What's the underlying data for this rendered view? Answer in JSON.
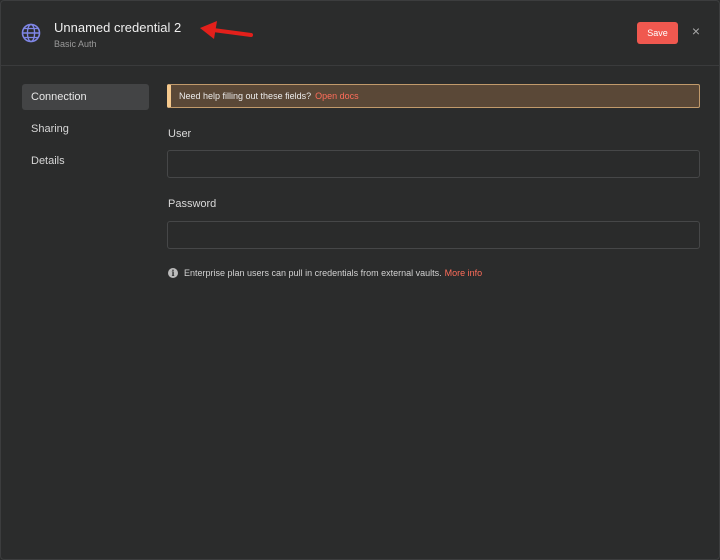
{
  "header": {
    "title": "Unnamed credential 2",
    "subtitle": "Basic Auth",
    "icon": "globe-icon",
    "save_label": "Save",
    "close_symbol": "×",
    "accent_color": "#f0584f"
  },
  "sidebar": {
    "items": [
      {
        "label": "Connection",
        "active": true
      },
      {
        "label": "Sharing",
        "active": false
      },
      {
        "label": "Details",
        "active": false
      }
    ]
  },
  "main": {
    "banner": {
      "text": "Need help filling out these fields?",
      "link": "Open docs"
    },
    "fields": [
      {
        "label": "User",
        "value": "",
        "placeholder": ""
      },
      {
        "label": "Password",
        "value": "",
        "placeholder": ""
      }
    ],
    "info": {
      "text": "Enterprise plan users can pull in credentials from external vaults.",
      "link": "More info"
    }
  }
}
